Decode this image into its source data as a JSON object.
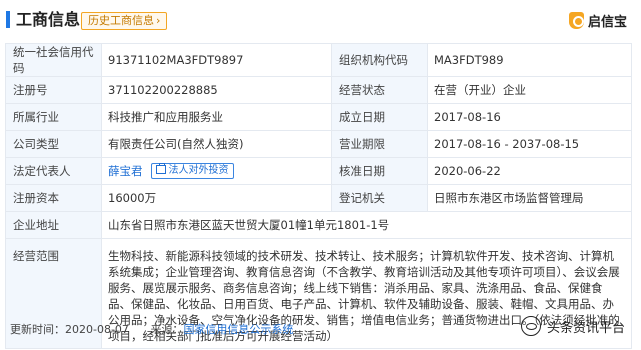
{
  "header": {
    "title": "工商信息",
    "history_button": "历史工商信息",
    "history_arrow": "›",
    "brand_name": "启信宝"
  },
  "rows": {
    "credit_code_label": "统一社会信用代码",
    "credit_code_value": "91371102MA3FDT9897",
    "org_code_label": "组织机构代码",
    "org_code_value": "MA3FDT989",
    "reg_no_label": "注册号",
    "reg_no_value": "371102200228885",
    "status_label": "经营状态",
    "status_value": "在营（开业）企业",
    "industry_label": "所属行业",
    "industry_value": "科技推广和应用服务业",
    "established_label": "成立日期",
    "established_value": "2017-08-16",
    "company_type_label": "公司类型",
    "company_type_value": "有限责任公司(自然人独资)",
    "term_label": "营业期限",
    "term_value": "2017-08-16 - 2037-08-15",
    "rep_label": "法定代表人",
    "rep_name": "薛宝君",
    "rep_invest_button": "法人对外投资",
    "approval_label": "核准日期",
    "approval_value": "2020-06-22",
    "capital_label": "注册资本",
    "capital_value": "16000万",
    "authority_label": "登记机关",
    "authority_value": "日照市东港区市场监督管理局",
    "address_label": "企业地址",
    "address_value": "山东省日照市东港区蓝天世贸大厦01幢1单元1801-1号",
    "scope_label": "经营范围",
    "scope_value": "生物科技、新能源科技领域的技术研发、技术转让、技术服务；计算机软件开发、技术咨询、计算机系统集成；企业管理咨询、教育信息咨询（不含教学、教育培训活动及其他专项许可项目）、会议会展服务、展览展示服务、商务信息咨询；线上线下销售：消杀用品、家具、洗涤用品、食品、保健食品、保健品、化妆品、日用百货、电子产品、计算机、软件及辅助设备、服装、鞋帽、文具用品、办公用品；净水设备、空气净化设备的研发、销售；增值电信业务；普通货物进出口。（依法须经批准的项目，经相关部门批准后方可开展经营活动）"
  },
  "footer": {
    "update_label": "更新时间：",
    "update_value": "2020-08-07",
    "source_label": "来源：",
    "source_link": "国家信用信息公示系统"
  },
  "watermark": {
    "text": "头条资讯平台"
  }
}
